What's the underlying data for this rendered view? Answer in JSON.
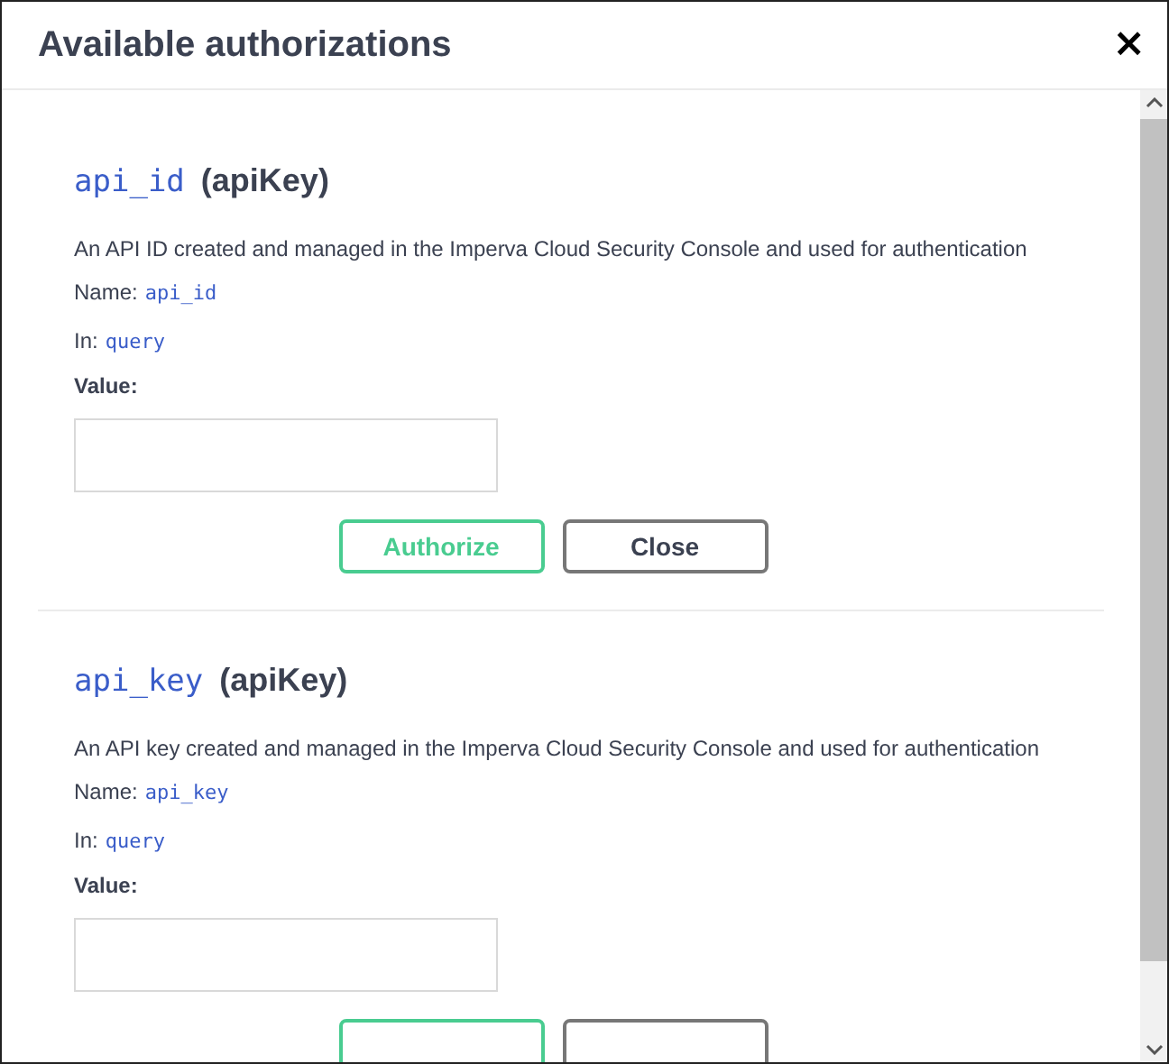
{
  "dialog": {
    "title": "Available authorizations",
    "close_icon": "×"
  },
  "schemes": [
    {
      "name": "api_id",
      "type": "(apiKey)",
      "description": "An API ID created and managed in the Imperva Cloud Security Console and used for authentication",
      "name_label": "Name:",
      "name_value": "api_id",
      "in_label": "In:",
      "in_value": "query",
      "value_label": "Value:",
      "buttons": [
        {
          "kind": "authorize",
          "label": "Authorize"
        },
        {
          "kind": "close",
          "label": "Close"
        }
      ]
    },
    {
      "name": "api_key",
      "type": "(apiKey)",
      "description": "An API key created and managed in the Imperva Cloud Security Console and used for authentication",
      "name_label": "Name:",
      "name_value": "api_key",
      "in_label": "In:",
      "in_value": "query",
      "value_label": "Value:",
      "buttons": [
        {
          "kind": "authorize"
        },
        {
          "kind": "close"
        }
      ]
    }
  ]
}
